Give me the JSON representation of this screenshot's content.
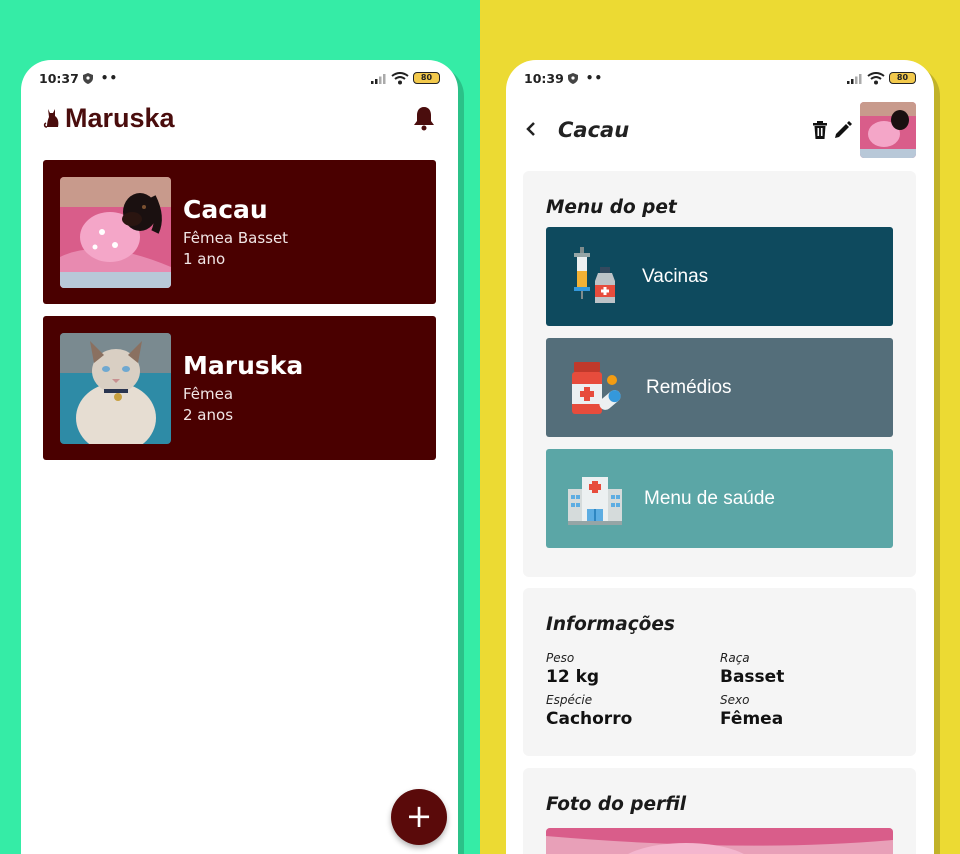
{
  "colors": {
    "left_bg": "#35ECA6",
    "right_bg": "#ECDA33",
    "card": "#4A0000",
    "brand": "#4A0D0D",
    "vacinas": "#0E4A5E",
    "remedios": "#546E7A",
    "saude": "#5BA6A6"
  },
  "left": {
    "status": {
      "time": "10:37",
      "battery": "80"
    },
    "app_title": "Maruska",
    "pets": [
      {
        "name": "Cacau",
        "line1": "Fêmea Basset",
        "line2": "1 ano"
      },
      {
        "name": "Maruska",
        "line1": "Fêmea",
        "line2": "2 anos"
      }
    ],
    "fab_label": "+"
  },
  "right": {
    "status": {
      "time": "10:39",
      "battery": "80"
    },
    "title": "Cacau",
    "menu": {
      "title": "Menu do pet",
      "items": [
        {
          "label": "Vacinas",
          "icon": "vaccine-icon"
        },
        {
          "label": "Remédios",
          "icon": "medicine-icon"
        },
        {
          "label": "Menu de saúde",
          "icon": "hospital-icon"
        }
      ]
    },
    "info": {
      "title": "Informações",
      "fields": [
        {
          "label": "Peso",
          "value": "12 kg"
        },
        {
          "label": "Raça",
          "value": "Basset"
        },
        {
          "label": "Espécie",
          "value": "Cachorro"
        },
        {
          "label": "Sexo",
          "value": "Fêmea"
        }
      ]
    },
    "profile": {
      "title": "Foto do perfil"
    }
  }
}
